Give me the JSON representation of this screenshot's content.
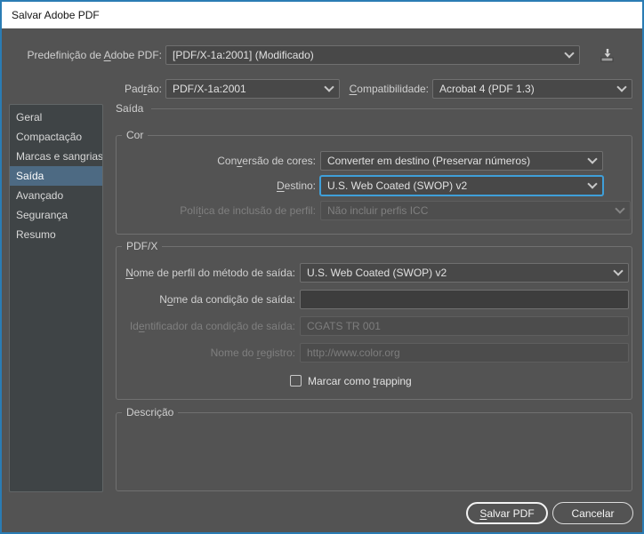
{
  "window": {
    "title": "Salvar Adobe PDF"
  },
  "header": {
    "preset": {
      "label": {
        "pre": "Predefinição de ",
        "key": "A",
        "post": "dobe PDF:"
      },
      "value": "[PDF/X-1a:2001] (Modificado)"
    },
    "standard": {
      "label": {
        "pre": "Pad",
        "key": "r",
        "post": "ão:"
      },
      "value": "PDF/X-1a:2001"
    },
    "compatibility": {
      "label": {
        "pre": "",
        "key": "C",
        "post": "ompatibilidade:"
      },
      "value": "Acrobat 4 (PDF 1.3)"
    }
  },
  "sidebar": {
    "selected_index": 3,
    "items": [
      {
        "label": "Geral"
      },
      {
        "label": "Compactação"
      },
      {
        "label": "Marcas e sangrias"
      },
      {
        "label": "Saída"
      },
      {
        "label": "Avançado"
      },
      {
        "label": "Segurança"
      },
      {
        "label": "Resumo"
      }
    ]
  },
  "panel": {
    "title": "Saída"
  },
  "color_group": {
    "title": "Cor",
    "conversion": {
      "label": {
        "pre": "Con",
        "key": "v",
        "post": "ersão de cores:"
      },
      "value": "Converter em destino (Preservar números)",
      "enabled": true
    },
    "destination": {
      "label": {
        "pre": "",
        "key": "D",
        "post": "estino:"
      },
      "value": "U.S. Web Coated (SWOP) v2",
      "enabled": true,
      "focused": true
    },
    "profile_policy": {
      "label": {
        "pre": "Polí",
        "key": "t",
        "post": "ica de inclusão de perfil:"
      },
      "value": "Não incluir perfis ICC",
      "enabled": false
    }
  },
  "pdfx_group": {
    "title": "PDF/X",
    "output_intent_profile": {
      "label": {
        "pre": "",
        "key": "N",
        "post": "ome de perfil do método de saída:"
      },
      "value": "U.S. Web Coated (SWOP) v2",
      "enabled": true
    },
    "output_condition_name": {
      "label": {
        "pre": "N",
        "key": "o",
        "post": "me da condição de saída:"
      },
      "value": "",
      "enabled": true
    },
    "output_condition_id": {
      "label": {
        "pre": "Id",
        "key": "e",
        "post": "ntificador da condição de saída:"
      },
      "value": "CGATS TR 001",
      "enabled": false
    },
    "registry_name": {
      "label": {
        "pre": "Nome do ",
        "key": "r",
        "post": "egistro:"
      },
      "value": "http://www.color.org",
      "enabled": false
    },
    "trapping": {
      "label": {
        "pre": "Marcar como ",
        "key": "t",
        "post": "rapping"
      },
      "checked": false
    }
  },
  "description_group": {
    "title": "Descrição",
    "content": ""
  },
  "footer": {
    "save": {
      "label": {
        "pre": "",
        "key": "S",
        "post": "alvar PDF"
      }
    },
    "cancel": {
      "label": "Cancelar"
    }
  },
  "colors": {
    "window_border": "#2a7cb4",
    "titlebar_bg": "#ffffff",
    "dialog_bg": "#535353",
    "sidebar_bg": "#3f4446",
    "sidebar_selected_bg": "#4d6a83",
    "focus_border": "#3f9fd9"
  }
}
